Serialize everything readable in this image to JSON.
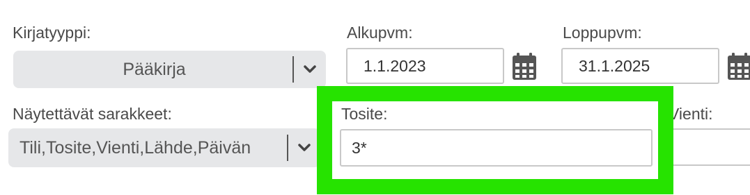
{
  "filters": {
    "kirjatyyppi": {
      "label": "Kirjatyyppi:",
      "value": "Pääkirja"
    },
    "alkupvm": {
      "label": "Alkupvm:",
      "value": "1.1.2023"
    },
    "loppupvm": {
      "label": "Loppupvm:",
      "value": "31.1.2025"
    },
    "sarakkeet": {
      "label": "Näytettävät sarakkeet:",
      "value": "Tili,Tosite,Vienti,Lähde,Päivän"
    },
    "tosite": {
      "label": "Tosite:",
      "value": "3*"
    },
    "vienti": {
      "label": "Vienti:",
      "value": ""
    }
  },
  "highlight_color": "#26e300",
  "icons": {
    "calendar": "calendar-icon",
    "chevron": "chevron-down-icon"
  }
}
